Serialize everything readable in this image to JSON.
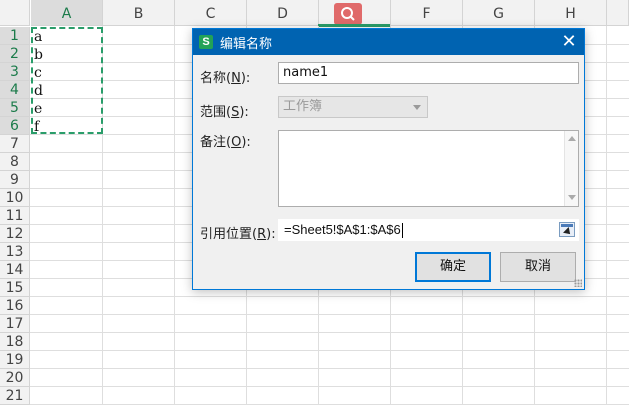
{
  "spreadsheet": {
    "columns": [
      "A",
      "B",
      "C",
      "D",
      "E",
      "F",
      "G",
      "H"
    ],
    "rows": [
      "1",
      "2",
      "3",
      "4",
      "5",
      "6",
      "7",
      "8",
      "9",
      "10",
      "11",
      "12",
      "13",
      "14",
      "15",
      "16",
      "17",
      "18",
      "19",
      "20",
      "21",
      "22"
    ],
    "column_a_values": [
      "a",
      "b",
      "c",
      "d",
      "e",
      "f"
    ]
  },
  "dialog": {
    "title": "编辑名称",
    "app_icon_letter": "S",
    "close_glyph": "✕",
    "name_label": "名称(",
    "name_key": "N",
    "name_label_end": "):",
    "name_value": "name1",
    "scope_label": "范围(",
    "scope_key": "S",
    "scope_label_end": "):",
    "scope_value": "工作簿",
    "note_label": "备注(",
    "note_key": "O",
    "note_label_end": "):",
    "ref_label": "引用位置(",
    "ref_key": "R",
    "ref_label_end": "):",
    "ref_value": "=Sheet5!$A$1:$A$6",
    "ok_label": "确定",
    "cancel_label": "取消"
  },
  "colors": {
    "accent": "#0078d7",
    "titlebar": "#0063b1",
    "marquee": "#2a9d6a",
    "search_tab": "#e06a6a"
  },
  "icons": {
    "app": "wps-spreadsheet-icon",
    "search": "search-icon",
    "collapse": "collapse-dialog-icon"
  }
}
